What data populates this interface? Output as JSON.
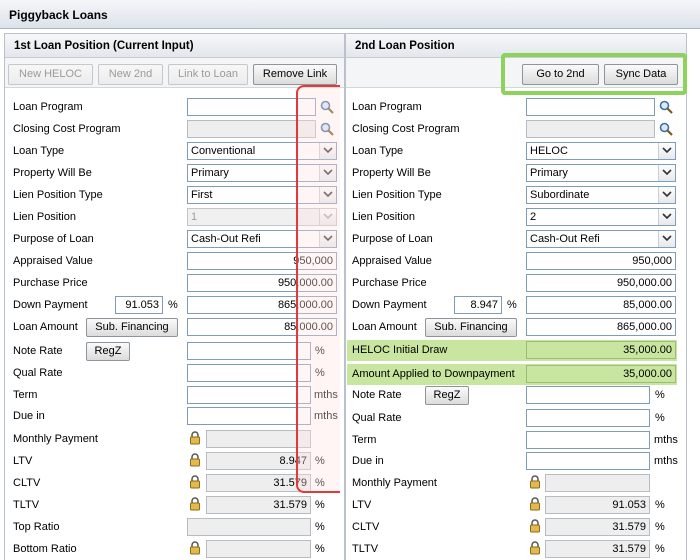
{
  "window": {
    "title": "Piggyback Loans"
  },
  "left": {
    "title": "1st Loan Position (Current Input)",
    "toolbar": {
      "new_heloc": "New HELOC",
      "new_2nd": "New 2nd",
      "link_to_loan": "Link to Loan",
      "remove_link": "Remove Link"
    },
    "labels": {
      "loan_program": "Loan Program",
      "closing_cost_program": "Closing Cost Program",
      "loan_type": "Loan Type",
      "property_will_be": "Property Will Be",
      "lien_position_type": "Lien Position Type",
      "lien_position": "Lien Position",
      "purpose_of_loan": "Purpose of Loan",
      "appraised_value": "Appraised Value",
      "purchase_price": "Purchase Price",
      "down_payment": "Down Payment",
      "loan_amount": "Loan Amount",
      "note_rate": "Note Rate",
      "qual_rate": "Qual Rate",
      "term": "Term",
      "due_in": "Due in",
      "monthly_payment": "Monthly Payment",
      "ltv": "LTV",
      "cltv": "CLTV",
      "tltv": "TLTV",
      "top_ratio": "Top Ratio",
      "bottom_ratio": "Bottom Ratio"
    },
    "values": {
      "loan_type": "Conventional",
      "property_will_be": "Primary",
      "lien_position_type": "First",
      "lien_position": "1",
      "purpose_of_loan": "Cash-Out Refi",
      "appraised_value": "950,000",
      "purchase_price": "950,000.00",
      "down_payment_pct": "91.053",
      "down_payment": "865,000.00",
      "loan_amount": "85,000.00",
      "ltv": "8.947",
      "cltv": "31.579",
      "tltv": "31.579"
    },
    "buttons": {
      "sub_financing": "Sub. Financing",
      "regz": "RegZ"
    },
    "units": {
      "pct": "%",
      "mths": "mths"
    }
  },
  "right": {
    "title": "2nd Loan Position",
    "toolbar": {
      "go_to_2nd": "Go to 2nd",
      "sync_data": "Sync Data"
    },
    "labels": {
      "loan_program": "Loan Program",
      "closing_cost_program": "Closing Cost Program",
      "loan_type": "Loan Type",
      "property_will_be": "Property Will Be",
      "lien_position_type": "Lien Position Type",
      "lien_position": "Lien Position",
      "purpose_of_loan": "Purpose of Loan",
      "appraised_value": "Appraised Value",
      "purchase_price": "Purchase Price",
      "down_payment": "Down Payment",
      "loan_amount": "Loan Amount",
      "heloc_initial_draw": "HELOC Initial Draw",
      "amount_applied": "Amount Applied to Downpayment",
      "note_rate": "Note Rate",
      "qual_rate": "Qual Rate",
      "term": "Term",
      "due_in": "Due in",
      "monthly_payment": "Monthly Payment",
      "ltv": "LTV",
      "cltv": "CLTV",
      "tltv": "TLTV"
    },
    "values": {
      "loan_type": "HELOC",
      "property_will_be": "Primary",
      "lien_position_type": "Subordinate",
      "lien_position": "2",
      "purpose_of_loan": "Cash-Out Refi",
      "appraised_value": "950,000",
      "purchase_price": "950,000.00",
      "down_payment_pct": "8.947",
      "down_payment": "85,000.00",
      "loan_amount": "865,000.00",
      "heloc_initial_draw": "35,000.00",
      "amount_applied": "35,000.00",
      "ltv": "91.053",
      "cltv": "31.579",
      "tltv": "31.579"
    },
    "buttons": {
      "sub_financing": "Sub. Financing",
      "regz": "RegZ"
    },
    "units": {
      "pct": "%",
      "mths": "mths"
    }
  },
  "colors": {
    "highlight_green": "#c8e6a0",
    "callout_green": "#8dd35a",
    "callout_red": "#e23a3a"
  },
  "icons": {
    "search": "search-icon",
    "lock": "lock-icon",
    "dropdown": "chevron-down-icon"
  }
}
